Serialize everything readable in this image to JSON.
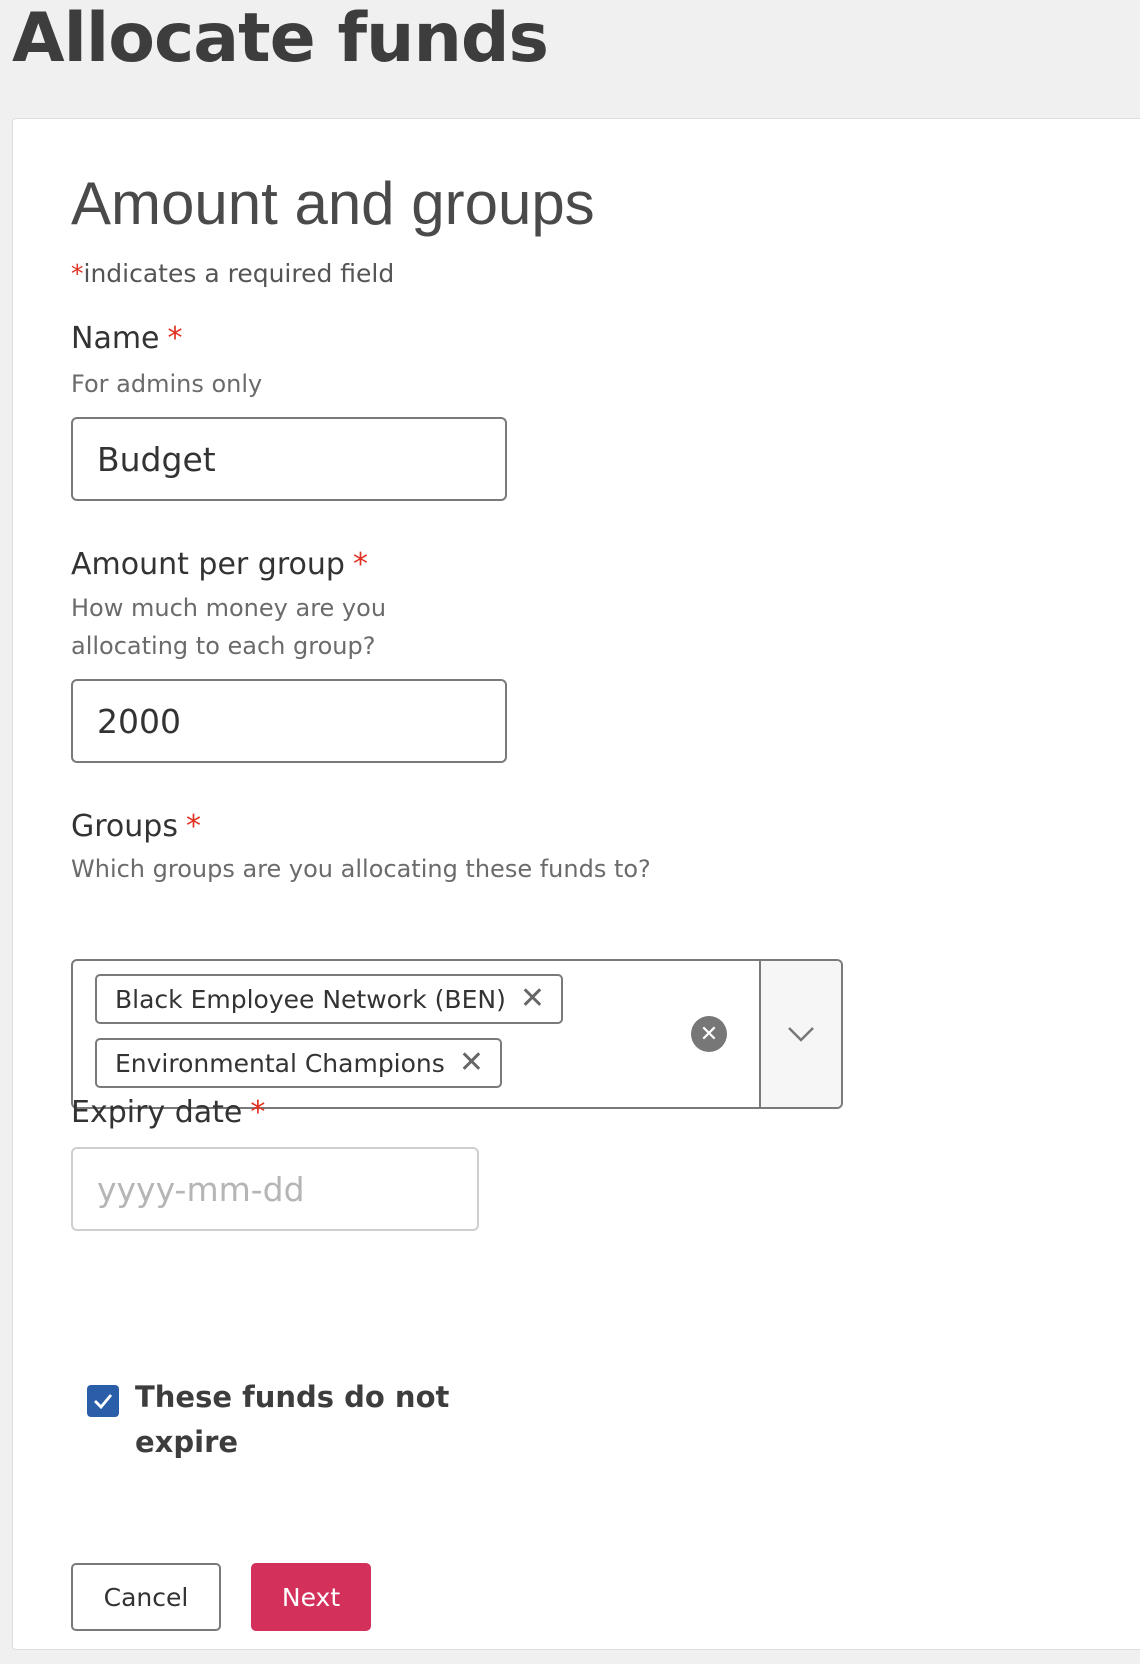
{
  "page": {
    "title": "Allocate funds"
  },
  "form": {
    "section_title": "Amount and groups",
    "required_marker": "*",
    "required_note": "indicates a required field",
    "name": {
      "label": "Name",
      "help": "For admins only",
      "value": "Budget"
    },
    "amount": {
      "label": "Amount per group",
      "help": "How much money are you allocating to each group?",
      "value": "2000"
    },
    "groups": {
      "label": "Groups",
      "help": "Which groups are you allocating these funds to?",
      "selected": [
        "Black Employee Network (BEN)",
        "Environmental Champions"
      ],
      "remove_glyph": "✕",
      "clear_glyph": "✕"
    },
    "expiry": {
      "label": "Expiry date",
      "placeholder": "yyyy-mm-dd",
      "value": ""
    },
    "no_expiry": {
      "label": "These funds do not expire",
      "checked": true
    }
  },
  "buttons": {
    "cancel": "Cancel",
    "next": "Next"
  },
  "colors": {
    "background": "#f0f0f0",
    "required_star": "#e03020",
    "checkbox": "#2b5ea8",
    "primary_button": "#d3305c"
  },
  "icons": {
    "chip_remove": "close-icon",
    "clear_all": "clear-circle-icon",
    "dropdown": "chevron-down-icon",
    "checkbox": "checkmark-icon"
  }
}
